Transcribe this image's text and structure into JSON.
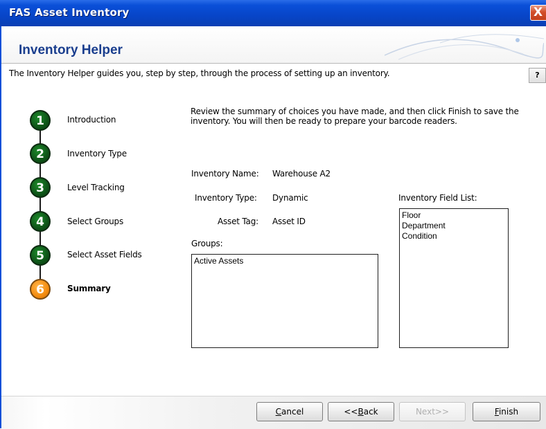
{
  "window": {
    "title": "FAS Asset Inventory",
    "close_glyph": "X"
  },
  "header": {
    "title": "Inventory Helper"
  },
  "intro": "The Inventory Helper guides you, step by step, through the process of setting up an inventory.",
  "help_label": "?",
  "steps": [
    {
      "number": "1",
      "label": "Introduction",
      "state": "done"
    },
    {
      "number": "2",
      "label": "Inventory Type",
      "state": "done"
    },
    {
      "number": "3",
      "label": "Level Tracking",
      "state": "done"
    },
    {
      "number": "4",
      "label": "Select Groups",
      "state": "done"
    },
    {
      "number": "5",
      "label": "Select Asset Fields",
      "state": "done"
    },
    {
      "number": "6",
      "label": "Summary",
      "state": "current"
    }
  ],
  "summary": {
    "description": "Review the summary of choices you have made, and then click Finish to save the inventory. You will then be ready to prepare your barcode readers.",
    "inventory_name_label": "Inventory Name:",
    "inventory_name": "Warehouse A2",
    "inventory_type_label": "Inventory Type:",
    "inventory_type": "Dynamic",
    "asset_tag_label": "Asset Tag:",
    "asset_tag": "Asset ID",
    "groups_label": "Groups:",
    "groups": [
      "Active Assets"
    ],
    "field_list_label": "Inventory Field List:",
    "fields": [
      "Floor",
      "Department",
      "Condition"
    ]
  },
  "buttons": {
    "cancel_mnemonic": "C",
    "cancel_rest": "ancel",
    "back_pre": "<<",
    "back_mnemonic": "B",
    "back_rest": "ack",
    "next": "Next>>",
    "finish_mnemonic": "F",
    "finish_rest": "inish"
  },
  "colors": {
    "done_step": "#0e5418",
    "current_step": "#f38c10",
    "title_bar": "#0a4fd8",
    "header_title": "#1a3e8e"
  }
}
